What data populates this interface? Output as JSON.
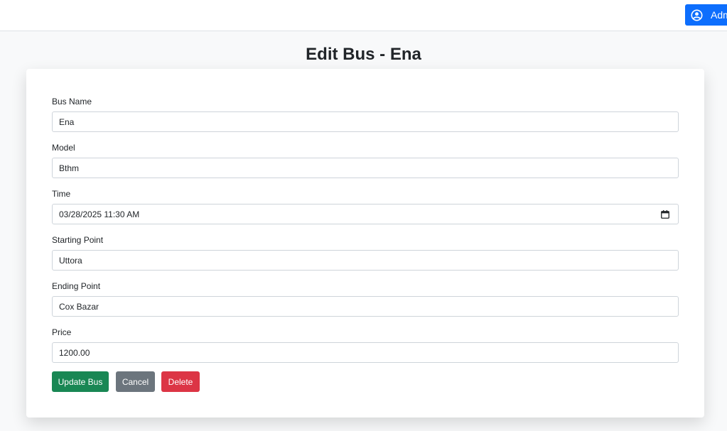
{
  "nav": {
    "user_label": "Admin"
  },
  "page": {
    "title": "Edit Bus - Ena"
  },
  "form": {
    "fields": [
      {
        "label": "Bus Name",
        "value": "Ena"
      },
      {
        "label": "Model",
        "value": "Bthm"
      },
      {
        "label": "Time",
        "value": "03/28/2025 11:30 AM"
      },
      {
        "label": "Starting Point",
        "value": "Uttora"
      },
      {
        "label": "Ending Point",
        "value": "Cox Bazar"
      },
      {
        "label": "Price",
        "value": "1200.00"
      }
    ],
    "buttons": {
      "update": "Update Bus",
      "cancel": "Cancel",
      "delete": "Delete"
    }
  },
  "colors": {
    "primary": "#0d6efd",
    "success": "#198754",
    "secondary": "#6c757d",
    "danger": "#dc3545"
  },
  "icons": {
    "user": "user-circle-icon",
    "calendar": "calendar-icon"
  }
}
